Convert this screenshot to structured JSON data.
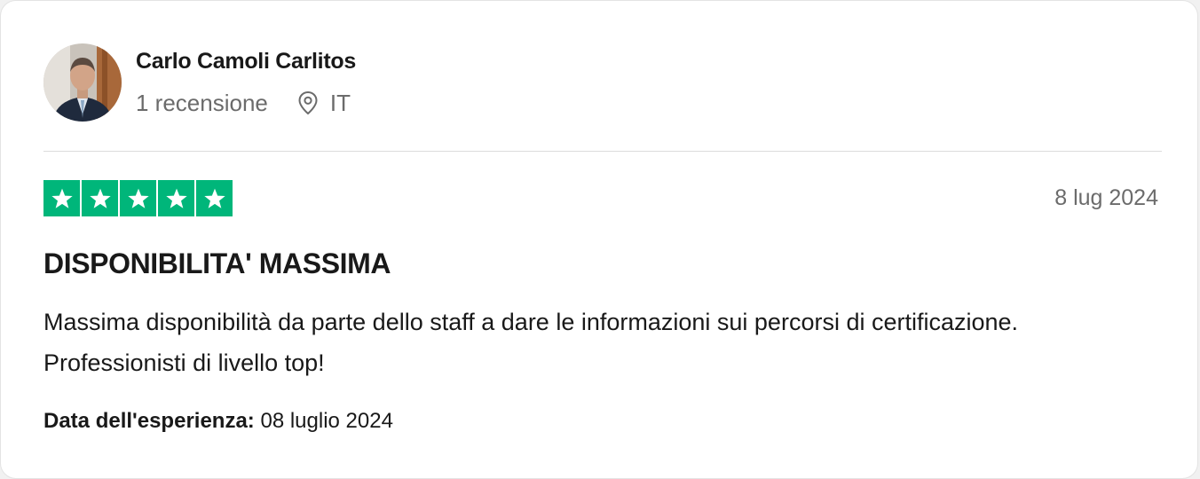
{
  "reviewer": {
    "name": "Carlo Camoli Carlitos",
    "reviews_count": "1 recensione",
    "country": "IT",
    "avatar_icon": "person-photo-avatar",
    "location_icon": "map-pin-icon"
  },
  "review": {
    "rating": 5,
    "rating_max": 5,
    "star_color": "#00b67a",
    "date": "8 lug 2024",
    "title": "DISPONIBILITA' MASSIMA",
    "body": "Massima disponibilità da parte dello staff a dare le informazioni sui percorsi di certificazione. Professionisti di livello top!",
    "experience_label": "Data dell'esperienza:",
    "experience_date": "08 luglio 2024"
  }
}
